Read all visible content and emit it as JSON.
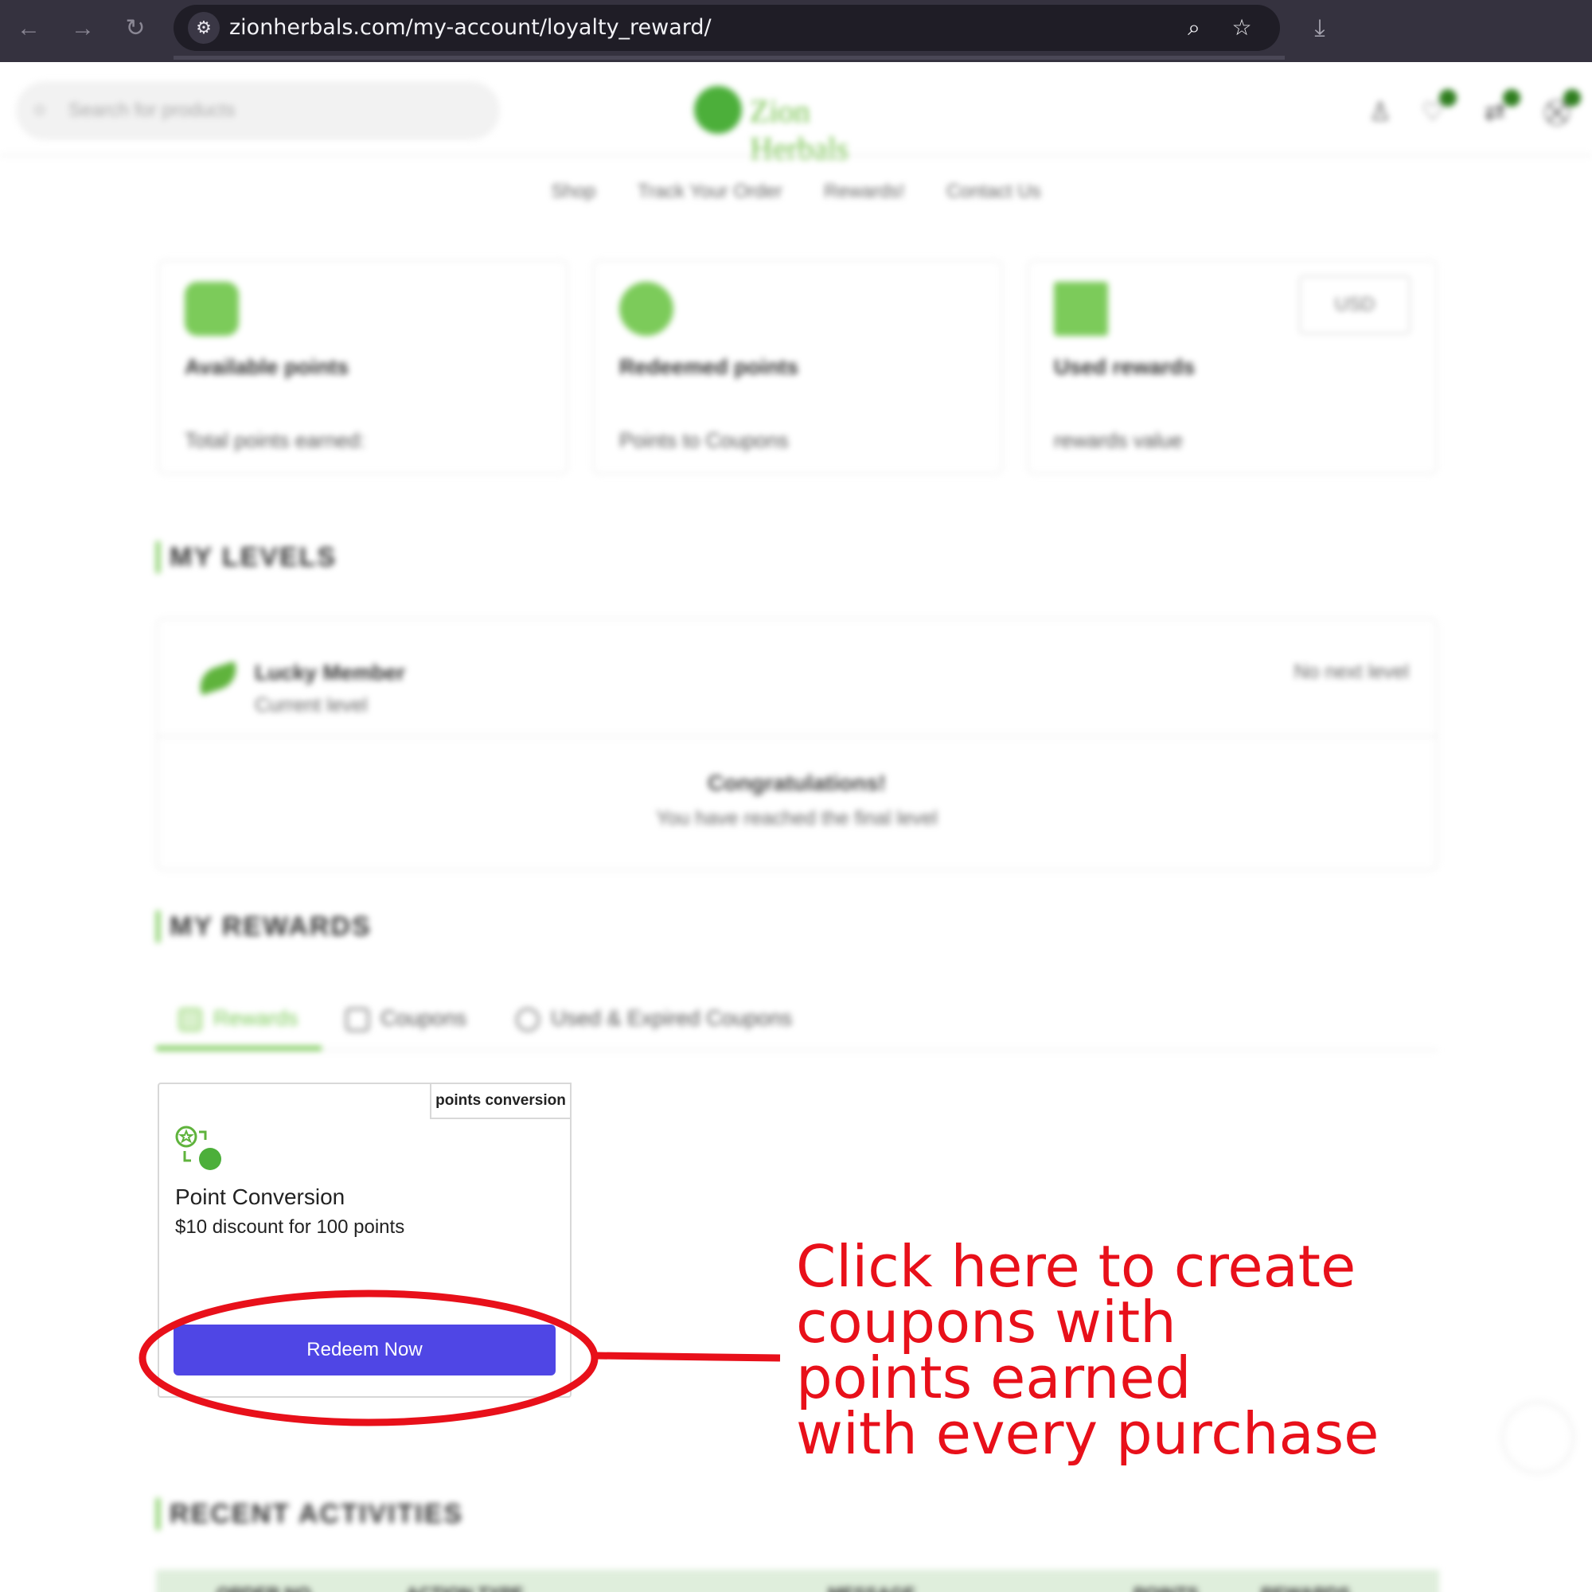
{
  "browser": {
    "url": "zionherbals.com/my-account/loyalty_reward/"
  },
  "site": {
    "search_placeholder": "Search for products",
    "logo_text": "Zion Herbals",
    "nav": [
      "Shop",
      "Track Your Order",
      "Rewards!",
      "Contact Us"
    ]
  },
  "stats": {
    "available": {
      "title": "Available points",
      "sub": "Total points earned:"
    },
    "redeemed": {
      "title": "Redeemed points",
      "sub": "Points to Coupons"
    },
    "used": {
      "title": "Used rewards",
      "sub": "rewards value",
      "currency": "USD"
    }
  },
  "levels": {
    "heading": "MY LEVELS",
    "level_name": "Lucky Member",
    "current_label": "Current level",
    "next_label": "No next level",
    "congrats": "Congratulations!",
    "final": "You have reached the final level"
  },
  "rewards": {
    "heading": "MY REWARDS",
    "tabs": [
      "Rewards",
      "Coupons",
      "Used & Expired Coupons"
    ],
    "card": {
      "badge": "points conversion",
      "title": "Point Conversion",
      "desc": "$10 discount for 100 points",
      "button": "Redeem Now"
    }
  },
  "annotation": {
    "lines": [
      "Click here to create",
      "coupons with",
      "points earned",
      "with every purchase"
    ],
    "color": "#e8101a"
  },
  "recent": {
    "heading": "RECENT ACTIVITIES",
    "columns": [
      "ORDER NO.",
      "ACTION TYPE",
      "MESSAGE",
      "POINTS",
      "REWARDS"
    ]
  },
  "colors": {
    "accent": "#7ccb5a",
    "button": "#4f46e5"
  }
}
